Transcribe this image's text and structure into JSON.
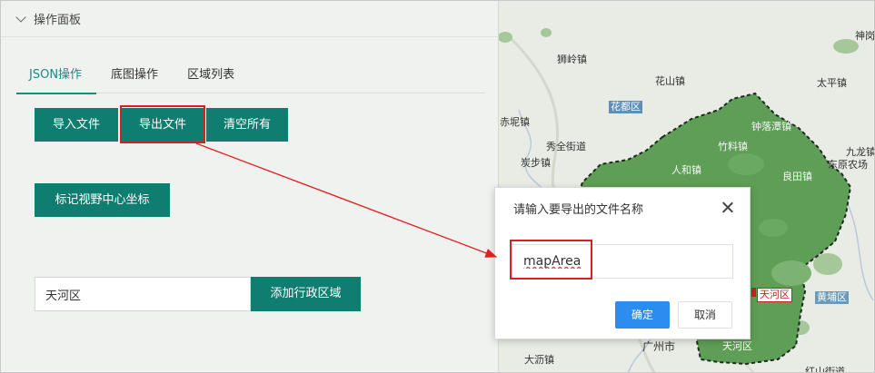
{
  "panel": {
    "title": "操作面板",
    "tabs": [
      {
        "label": "JSON操作",
        "active": true
      },
      {
        "label": "底图操作",
        "active": false
      },
      {
        "label": "区域列表",
        "active": false
      }
    ],
    "buttons": {
      "import": "导入文件",
      "export": "导出文件",
      "clear": "清空所有",
      "center": "标记视野中心坐标",
      "add_district": "添加行政区域"
    },
    "district_input_value": "天河区"
  },
  "dialog": {
    "title": "请输入要导出的文件名称",
    "input_value": "mapArea",
    "ok_label": "确定",
    "cancel_label": "取消"
  },
  "map": {
    "labels": {
      "shenjing": "神岗",
      "shiling": "狮岭镇",
      "huashan": "花山镇",
      "taiping": "太平镇",
      "chini": "赤坭镇",
      "zhonglouta": "钟落潭镇",
      "xiuquan": "秀全街道",
      "zhuliao": "竹料镇",
      "jiulong": "九龙镇",
      "tanbu": "炭步镇",
      "renhe": "人和镇",
      "dongyuan": "东原农场",
      "liangtian": "良田镇",
      "guangzhou": "广州市",
      "dali": "大沥镇",
      "hongshan": "红山街道"
    },
    "badges": {
      "huadu": "花都区",
      "tianhe_red": "天河区",
      "huangpu": "黄埔区",
      "tianhe_green": "天河区"
    }
  },
  "colors": {
    "accent": "#0f7d70",
    "tab_active": "#1d8a80",
    "highlight": "#d42222",
    "primary": "#2d8cf0",
    "region_fill": "#5f9e56"
  }
}
